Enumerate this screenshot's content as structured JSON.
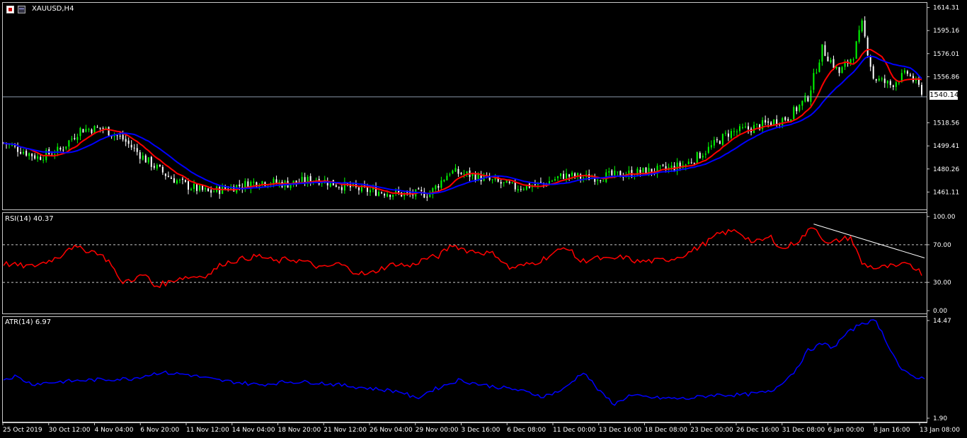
{
  "window": {
    "title": "XAUUSD,H4"
  },
  "colors": {
    "background": "#000000",
    "bull_candle": "#00ff00",
    "bear_candle": "#ffffff",
    "ma_fast": "#ff0000",
    "ma_slow": "#0000ff",
    "rsi_line": "#ff0000",
    "atr_line": "#0000ff",
    "grid_text": "#ffffff"
  },
  "price_tag": "1540.14",
  "chart_data": [
    {
      "type": "candlestick",
      "title": "XAUUSD,H4",
      "ylim": [
        1449,
        1617
      ],
      "y_ticks": [
        "1614.31",
        "1595.16",
        "1576.01",
        "1556.86",
        "1518.56",
        "1499.41",
        "1480.26",
        "1461.11"
      ],
      "current_price": 1540.14,
      "anchors": [
        [
          0,
          1502
        ],
        [
          5,
          1497
        ],
        [
          12,
          1490
        ],
        [
          20,
          1496
        ],
        [
          27,
          1513
        ],
        [
          35,
          1514
        ],
        [
          42,
          1505
        ],
        [
          50,
          1488
        ],
        [
          58,
          1474
        ],
        [
          65,
          1466
        ],
        [
          72,
          1461
        ],
        [
          80,
          1465
        ],
        [
          90,
          1470
        ],
        [
          100,
          1468
        ],
        [
          110,
          1472
        ],
        [
          118,
          1467
        ],
        [
          126,
          1463
        ],
        [
          134,
          1461
        ],
        [
          142,
          1459
        ],
        [
          150,
          1460
        ],
        [
          157,
          1478
        ],
        [
          165,
          1475
        ],
        [
          172,
          1470
        ],
        [
          180,
          1465
        ],
        [
          190,
          1468
        ],
        [
          197,
          1475
        ],
        [
          205,
          1473
        ],
        [
          215,
          1475
        ],
        [
          225,
          1478
        ],
        [
          233,
          1480
        ],
        [
          240,
          1484
        ],
        [
          248,
          1497
        ],
        [
          255,
          1510
        ],
        [
          263,
          1514
        ],
        [
          270,
          1519
        ],
        [
          276,
          1523
        ],
        [
          283,
          1540
        ],
        [
          288,
          1580
        ],
        [
          294,
          1560
        ],
        [
          299,
          1575
        ],
        [
          302,
          1600
        ],
        [
          306,
          1556
        ],
        [
          312,
          1550
        ],
        [
          318,
          1560
        ],
        [
          323,
          1545
        ]
      ],
      "moving_averages": [
        {
          "color": "#ff0000",
          "period": 10
        },
        {
          "color": "#0000ff",
          "period": 20
        }
      ]
    },
    {
      "type": "line",
      "title": "RSI(14) 40.37",
      "ylim": [
        0,
        100
      ],
      "y_ticks": [
        "100.00",
        "70.00",
        "30.00",
        "0.00"
      ],
      "levels": [
        70,
        30
      ],
      "anchors": [
        [
          0,
          50
        ],
        [
          5,
          48
        ],
        [
          10,
          47
        ],
        [
          15,
          52
        ],
        [
          20,
          58
        ],
        [
          23,
          68
        ],
        [
          28,
          65
        ],
        [
          33,
          62
        ],
        [
          38,
          50
        ],
        [
          41,
          30
        ],
        [
          45,
          33
        ],
        [
          50,
          38
        ],
        [
          53,
          26
        ],
        [
          58,
          30
        ],
        [
          62,
          35
        ],
        [
          67,
          36
        ],
        [
          72,
          38
        ],
        [
          77,
          50
        ],
        [
          84,
          55
        ],
        [
          90,
          58
        ],
        [
          96,
          52
        ],
        [
          100,
          55
        ],
        [
          106,
          52
        ],
        [
          112,
          45
        ],
        [
          118,
          50
        ],
        [
          123,
          42
        ],
        [
          128,
          38
        ],
        [
          133,
          45
        ],
        [
          138,
          50
        ],
        [
          143,
          47
        ],
        [
          148,
          55
        ],
        [
          153,
          58
        ],
        [
          158,
          70
        ],
        [
          163,
          64
        ],
        [
          168,
          62
        ],
        [
          173,
          60
        ],
        [
          178,
          45
        ],
        [
          183,
          48
        ],
        [
          188,
          52
        ],
        [
          193,
          60
        ],
        [
          198,
          68
        ],
        [
          203,
          52
        ],
        [
          208,
          56
        ],
        [
          213,
          54
        ],
        [
          218,
          57
        ],
        [
          223,
          52
        ],
        [
          230,
          53
        ],
        [
          235,
          55
        ],
        [
          240,
          60
        ],
        [
          246,
          70
        ],
        [
          252,
          82
        ],
        [
          258,
          85
        ],
        [
          264,
          72
        ],
        [
          270,
          78
        ],
        [
          274,
          65
        ],
        [
          280,
          75
        ],
        [
          285,
          90
        ],
        [
          290,
          70
        ],
        [
          294,
          75
        ],
        [
          298,
          78
        ],
        [
          302,
          50
        ],
        [
          307,
          45
        ],
        [
          312,
          47
        ],
        [
          315,
          46
        ],
        [
          318,
          52
        ],
        [
          323,
          40
        ]
      ],
      "trendline": {
        "from": [
          285,
          92
        ],
        "to": [
          324,
          56
        ],
        "color": "#ffffff"
      }
    },
    {
      "type": "line",
      "title": "ATR(14) 6.97",
      "ylim": [
        1.9,
        14.47
      ],
      "y_ticks": [
        "14.47",
        "1.90"
      ],
      "anchors": [
        [
          0,
          6.9
        ],
        [
          4,
          7.3
        ],
        [
          10,
          6.3
        ],
        [
          20,
          6.6
        ],
        [
          30,
          6.8
        ],
        [
          45,
          7.0
        ],
        [
          55,
          7.8
        ],
        [
          65,
          7.5
        ],
        [
          75,
          6.8
        ],
        [
          90,
          6.2
        ],
        [
          100,
          6.6
        ],
        [
          110,
          6.5
        ],
        [
          125,
          5.9
        ],
        [
          140,
          5.3
        ],
        [
          145,
          4.4
        ],
        [
          150,
          5.4
        ],
        [
          160,
          6.8
        ],
        [
          170,
          6.1
        ],
        [
          180,
          5.6
        ],
        [
          190,
          4.7
        ],
        [
          197,
          5.6
        ],
        [
          204,
          7.9
        ],
        [
          210,
          5.2
        ],
        [
          215,
          3.7
        ],
        [
          220,
          4.8
        ],
        [
          230,
          4.5
        ],
        [
          240,
          4.4
        ],
        [
          250,
          4.9
        ],
        [
          260,
          4.9
        ],
        [
          270,
          5.3
        ],
        [
          278,
          7.8
        ],
        [
          283,
          10.6
        ],
        [
          288,
          11.5
        ],
        [
          292,
          11.0
        ],
        [
          296,
          12.6
        ],
        [
          302,
          14.2
        ],
        [
          307,
          14.4
        ],
        [
          311,
          11.5
        ],
        [
          316,
          8.0
        ],
        [
          320,
          7.3
        ],
        [
          324,
          6.97
        ]
      ]
    }
  ],
  "x_axis": {
    "labels": [
      "25 Oct 2019",
      "30 Oct 12:00",
      "4 Nov 04:00",
      "6 Nov 20:00",
      "11 Nov 12:00",
      "14 Nov 04:00",
      "18 Nov 20:00",
      "21 Nov 12:00",
      "26 Nov 04:00",
      "29 Nov 00:00",
      "3 Dec 16:00",
      "6 Dec 08:00",
      "11 Dec 00:00",
      "13 Dec 16:00",
      "18 Dec 08:00",
      "23 Dec 00:00",
      "26 Dec 16:00",
      "31 Dec 08:00",
      "6 Jan 00:00",
      "8 Jan 16:00",
      "13 Jan 08:00"
    ]
  }
}
